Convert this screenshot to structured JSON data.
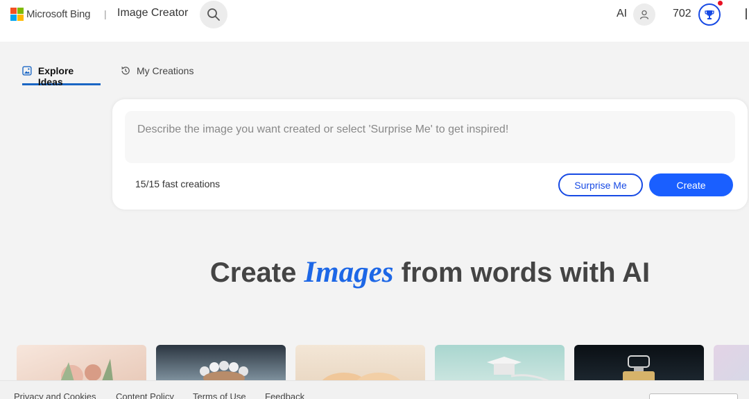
{
  "header": {
    "brand": "Microsoft Bing",
    "divider": "|",
    "app_title": "Image Creator",
    "ai_label": "AI",
    "points": "702",
    "logo_colors": [
      "#f25022",
      "#7fba00",
      "#00a4ef",
      "#ffb900"
    ],
    "accent_color": "#174ae4",
    "notification_color": "#e81123"
  },
  "tabs": [
    {
      "label": "Explore Ideas",
      "icon": "image-icon",
      "active": true
    },
    {
      "label": "My Creations",
      "icon": "history-icon",
      "active": false
    }
  ],
  "prompt": {
    "placeholder": "Describe the image you want created or select 'Surprise Me' to get inspired!",
    "value": "",
    "fast_creations": "15/15 fast creations",
    "surprise_label": "Surprise Me",
    "create_label": "Create"
  },
  "hero": {
    "before": "Create",
    "accent": "Images",
    "after": "from words with AI"
  },
  "gallery": [
    {
      "subject": "floral arrangement",
      "colors": [
        "#f7e6dc",
        "#e8c9b8"
      ]
    },
    {
      "subject": "pearl jewelry",
      "colors": [
        "#2b3540",
        "#8ca0ad"
      ]
    },
    {
      "subject": "portraits",
      "colors": [
        "#e9d7c2",
        "#f3e6d6"
      ]
    },
    {
      "subject": "graduation cap",
      "colors": [
        "#a9d6cf",
        "#cfe7e2"
      ]
    },
    {
      "subject": "perfume bottle",
      "colors": [
        "#0a0f14",
        "#1f2a33"
      ]
    },
    {
      "subject": "abstract",
      "colors": [
        "#e3d3e6",
        "#c7dfe8"
      ]
    }
  ],
  "footer": {
    "links": [
      "Privacy and Cookies",
      "Content Policy",
      "Terms of Use",
      "Feedback"
    ]
  }
}
